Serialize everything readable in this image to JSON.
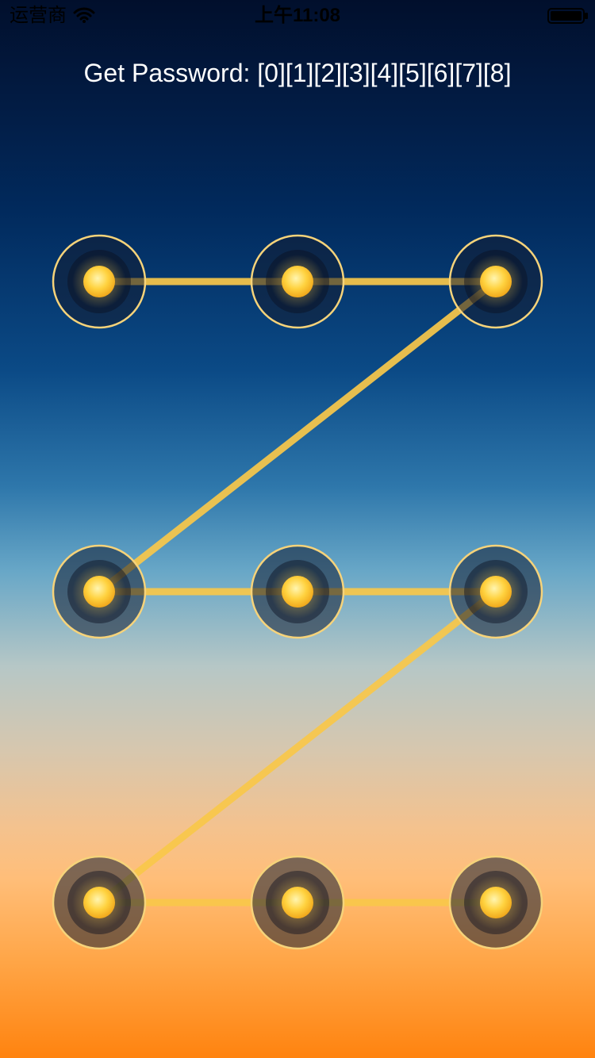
{
  "status_bar": {
    "carrier": "运营商",
    "time": "上午11:08",
    "wifi_icon": "wifi-icon",
    "battery_icon": "battery-icon"
  },
  "password_label": "Get Password: [0][1][2][3][4][5][6][7][8]",
  "lock_pattern": {
    "columns": 3,
    "rows": 3,
    "selected_sequence": [
      0,
      1,
      2,
      3,
      4,
      5,
      6,
      7,
      8
    ],
    "line_color": "#f9c84a",
    "node_ring_color": "#f6d37a",
    "node_core_color": "#ffcf3a"
  }
}
